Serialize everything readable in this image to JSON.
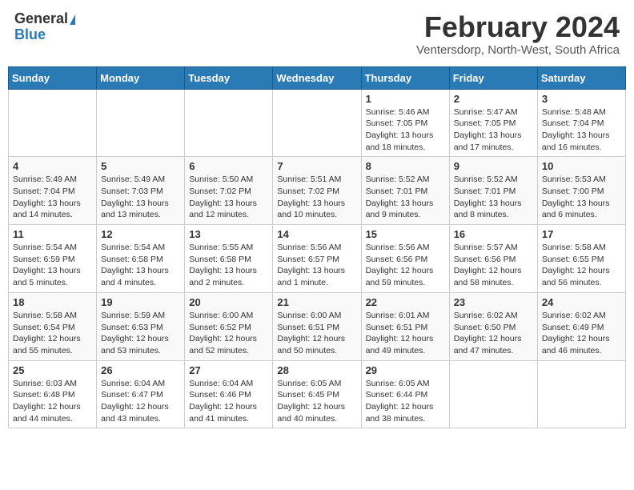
{
  "logo": {
    "general": "General",
    "blue": "Blue"
  },
  "header": {
    "month": "February 2024",
    "location": "Ventersdorp, North-West, South Africa"
  },
  "weekdays": [
    "Sunday",
    "Monday",
    "Tuesday",
    "Wednesday",
    "Thursday",
    "Friday",
    "Saturday"
  ],
  "weeks": [
    [
      {
        "day": "",
        "info": ""
      },
      {
        "day": "",
        "info": ""
      },
      {
        "day": "",
        "info": ""
      },
      {
        "day": "",
        "info": ""
      },
      {
        "day": "1",
        "info": "Sunrise: 5:46 AM\nSunset: 7:05 PM\nDaylight: 13 hours\nand 18 minutes."
      },
      {
        "day": "2",
        "info": "Sunrise: 5:47 AM\nSunset: 7:05 PM\nDaylight: 13 hours\nand 17 minutes."
      },
      {
        "day": "3",
        "info": "Sunrise: 5:48 AM\nSunset: 7:04 PM\nDaylight: 13 hours\nand 16 minutes."
      }
    ],
    [
      {
        "day": "4",
        "info": "Sunrise: 5:49 AM\nSunset: 7:04 PM\nDaylight: 13 hours\nand 14 minutes."
      },
      {
        "day": "5",
        "info": "Sunrise: 5:49 AM\nSunset: 7:03 PM\nDaylight: 13 hours\nand 13 minutes."
      },
      {
        "day": "6",
        "info": "Sunrise: 5:50 AM\nSunset: 7:02 PM\nDaylight: 13 hours\nand 12 minutes."
      },
      {
        "day": "7",
        "info": "Sunrise: 5:51 AM\nSunset: 7:02 PM\nDaylight: 13 hours\nand 10 minutes."
      },
      {
        "day": "8",
        "info": "Sunrise: 5:52 AM\nSunset: 7:01 PM\nDaylight: 13 hours\nand 9 minutes."
      },
      {
        "day": "9",
        "info": "Sunrise: 5:52 AM\nSunset: 7:01 PM\nDaylight: 13 hours\nand 8 minutes."
      },
      {
        "day": "10",
        "info": "Sunrise: 5:53 AM\nSunset: 7:00 PM\nDaylight: 13 hours\nand 6 minutes."
      }
    ],
    [
      {
        "day": "11",
        "info": "Sunrise: 5:54 AM\nSunset: 6:59 PM\nDaylight: 13 hours\nand 5 minutes."
      },
      {
        "day": "12",
        "info": "Sunrise: 5:54 AM\nSunset: 6:58 PM\nDaylight: 13 hours\nand 4 minutes."
      },
      {
        "day": "13",
        "info": "Sunrise: 5:55 AM\nSunset: 6:58 PM\nDaylight: 13 hours\nand 2 minutes."
      },
      {
        "day": "14",
        "info": "Sunrise: 5:56 AM\nSunset: 6:57 PM\nDaylight: 13 hours\nand 1 minute."
      },
      {
        "day": "15",
        "info": "Sunrise: 5:56 AM\nSunset: 6:56 PM\nDaylight: 12 hours\nand 59 minutes."
      },
      {
        "day": "16",
        "info": "Sunrise: 5:57 AM\nSunset: 6:56 PM\nDaylight: 12 hours\nand 58 minutes."
      },
      {
        "day": "17",
        "info": "Sunrise: 5:58 AM\nSunset: 6:55 PM\nDaylight: 12 hours\nand 56 minutes."
      }
    ],
    [
      {
        "day": "18",
        "info": "Sunrise: 5:58 AM\nSunset: 6:54 PM\nDaylight: 12 hours\nand 55 minutes."
      },
      {
        "day": "19",
        "info": "Sunrise: 5:59 AM\nSunset: 6:53 PM\nDaylight: 12 hours\nand 53 minutes."
      },
      {
        "day": "20",
        "info": "Sunrise: 6:00 AM\nSunset: 6:52 PM\nDaylight: 12 hours\nand 52 minutes."
      },
      {
        "day": "21",
        "info": "Sunrise: 6:00 AM\nSunset: 6:51 PM\nDaylight: 12 hours\nand 50 minutes."
      },
      {
        "day": "22",
        "info": "Sunrise: 6:01 AM\nSunset: 6:51 PM\nDaylight: 12 hours\nand 49 minutes."
      },
      {
        "day": "23",
        "info": "Sunrise: 6:02 AM\nSunset: 6:50 PM\nDaylight: 12 hours\nand 47 minutes."
      },
      {
        "day": "24",
        "info": "Sunrise: 6:02 AM\nSunset: 6:49 PM\nDaylight: 12 hours\nand 46 minutes."
      }
    ],
    [
      {
        "day": "25",
        "info": "Sunrise: 6:03 AM\nSunset: 6:48 PM\nDaylight: 12 hours\nand 44 minutes."
      },
      {
        "day": "26",
        "info": "Sunrise: 6:04 AM\nSunset: 6:47 PM\nDaylight: 12 hours\nand 43 minutes."
      },
      {
        "day": "27",
        "info": "Sunrise: 6:04 AM\nSunset: 6:46 PM\nDaylight: 12 hours\nand 41 minutes."
      },
      {
        "day": "28",
        "info": "Sunrise: 6:05 AM\nSunset: 6:45 PM\nDaylight: 12 hours\nand 40 minutes."
      },
      {
        "day": "29",
        "info": "Sunrise: 6:05 AM\nSunset: 6:44 PM\nDaylight: 12 hours\nand 38 minutes."
      },
      {
        "day": "",
        "info": ""
      },
      {
        "day": "",
        "info": ""
      }
    ]
  ]
}
